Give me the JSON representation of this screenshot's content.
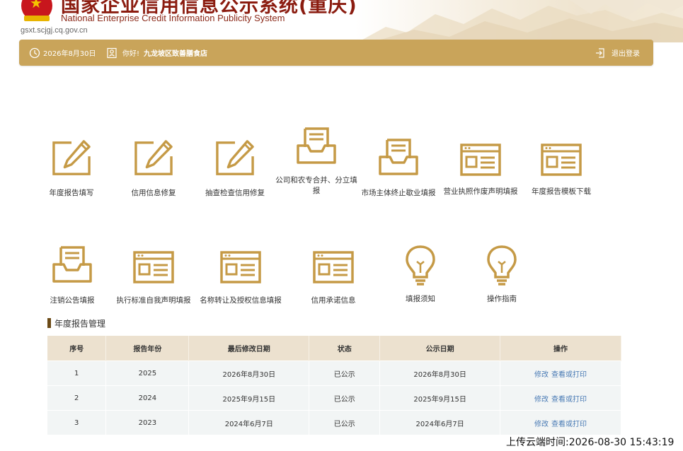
{
  "header": {
    "title_cn": "国家企业信用信息公示系统(重庆)",
    "title_en": "National Enterprise Credit Information Publicity System",
    "url": "gsxt.scjgj.cq.gov.cn"
  },
  "topbar": {
    "date": "2026年8月30日",
    "greeting": "你好!",
    "user": "九龙坡区致善膳食店",
    "logout": "退出登录"
  },
  "tiles_row1": [
    {
      "label": "年度报告填写",
      "icon": "edit-icon"
    },
    {
      "label": "信用信息修复",
      "icon": "edit-icon"
    },
    {
      "label": "抽查检查信用修复",
      "icon": "edit-icon"
    },
    {
      "label": "公司和农专合并、分立填报",
      "icon": "inbox-tray-icon"
    },
    {
      "label": "市场主体终止歇业填报",
      "icon": "inbox-tray-icon"
    },
    {
      "label": "营业执照作废声明填报",
      "icon": "browser-window-icon"
    },
    {
      "label": "年度报告模板下载",
      "icon": "browser-window-icon"
    }
  ],
  "tiles_row2": [
    {
      "label": "注销公告填报",
      "icon": "inbox-tray-icon"
    },
    {
      "label": "执行标准自我声明填报",
      "icon": "browser-window-icon"
    },
    {
      "label": "名称转让及授权信息填报",
      "icon": "browser-window-icon"
    },
    {
      "label": "信用承诺信息",
      "icon": "browser-window-icon"
    },
    {
      "label": "填报须知",
      "icon": "lightbulb-icon"
    },
    {
      "label": "操作指南",
      "icon": "lightbulb-icon"
    }
  ],
  "report_section": {
    "title": "年度报告管理",
    "columns": [
      "序号",
      "报告年份",
      "最后修改日期",
      "状态",
      "公示日期",
      "操作"
    ],
    "rows": [
      {
        "no": "1",
        "year": "2025",
        "modified": "2026年8月30日",
        "status": "已公示",
        "published": "2026年8月30日",
        "op_edit": "修改",
        "op_view": "查看或打印"
      },
      {
        "no": "2",
        "year": "2024",
        "modified": "2025年9月15日",
        "status": "已公示",
        "published": "2025年9月15日",
        "op_edit": "修改",
        "op_view": "查看或打印"
      },
      {
        "no": "3",
        "year": "2023",
        "modified": "2024年6月7日",
        "status": "已公示",
        "published": "2024年6月7日",
        "op_edit": "修改",
        "op_view": "查看或打印"
      }
    ]
  },
  "upload_time": "上传云端时间:2026-08-30 15:43:19",
  "colors": {
    "gold": "#c9a45a",
    "icon_gold": "#c59a46",
    "title_red": "#8b1c10",
    "table_header": "#ece1cf",
    "link_blue": "#4a7bb5"
  }
}
